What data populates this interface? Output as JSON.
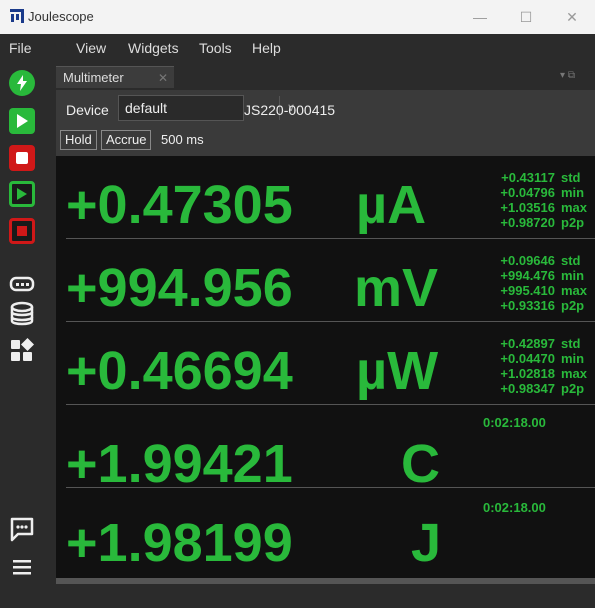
{
  "window": {
    "title": "Joulescope"
  },
  "menu": [
    "File",
    "View",
    "Widgets",
    "Tools",
    "Help"
  ],
  "tab": {
    "label": "Multimeter"
  },
  "controls": {
    "device_label": "Device",
    "device_value": "default",
    "serial": "JS220-000415",
    "hold_label": "Hold",
    "accrue_label": "Accrue",
    "duration": "500 ms"
  },
  "rows": [
    {
      "value": "+0.47305",
      "unit": "µA",
      "stats": [
        [
          "+0.43117",
          "std"
        ],
        [
          "+0.04796",
          "min"
        ],
        [
          "+1.03516",
          "max"
        ],
        [
          "+0.98720",
          "p2p"
        ]
      ]
    },
    {
      "value": "+994.956",
      "unit": "mV",
      "stats": [
        [
          "+0.09646",
          "std"
        ],
        [
          "+994.476",
          "min"
        ],
        [
          "+995.410",
          "max"
        ],
        [
          "+0.93316",
          "p2p"
        ]
      ]
    },
    {
      "value": "+0.46694",
      "unit": "µW",
      "stats": [
        [
          "+0.42897",
          "std"
        ],
        [
          "+0.04470",
          "min"
        ],
        [
          "+1.02818",
          "max"
        ],
        [
          "+0.98347",
          "p2p"
        ]
      ]
    },
    {
      "value": "+1.99421",
      "unit": "C",
      "time": "0:02:18.00"
    },
    {
      "value": "+1.98199",
      "unit": "J",
      "time": "0:02:18.00"
    }
  ],
  "colors": {
    "accent_green": "#29b93b"
  },
  "icons": [
    "bolt-icon",
    "play-icon",
    "stop-icon",
    "play-outline-icon",
    "stop-outline-icon",
    "keyboard-icon",
    "database-icon",
    "widgets-icon",
    "chat-icon",
    "hamburger-icon"
  ]
}
